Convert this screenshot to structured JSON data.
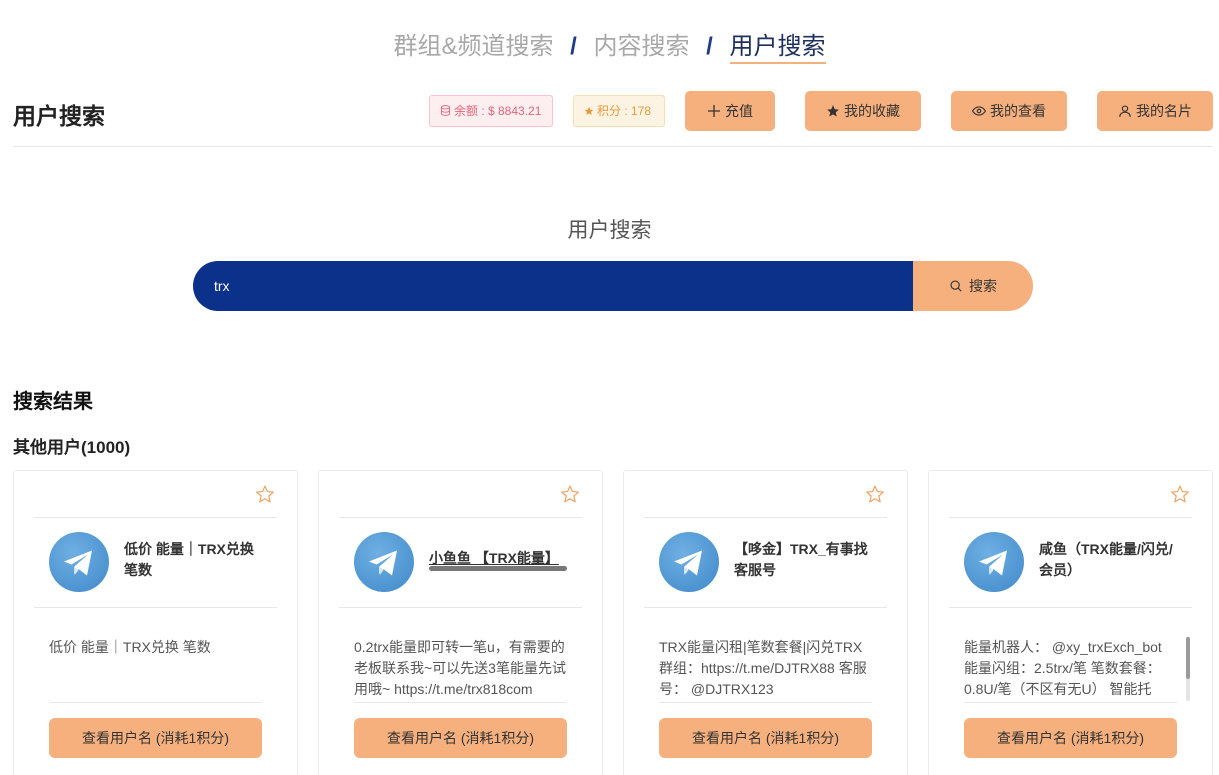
{
  "tabs": [
    {
      "label": "群组&频道搜索"
    },
    {
      "label": "内容搜索"
    },
    {
      "label": "用户搜索"
    }
  ],
  "tab_separator": "/",
  "header": {
    "title": "用户搜索",
    "balance": "余额 : $ 8843.21",
    "points": "积分 : 178",
    "recharge_label": "充值",
    "favorites_label": "我的收藏",
    "viewed_label": "我的查看",
    "card_label": "我的名片"
  },
  "search": {
    "title": "用户搜索",
    "value": "trx",
    "button_label": "搜索"
  },
  "results": {
    "title": "搜索结果",
    "others_title": "其他用户(1000)",
    "cards": [
      {
        "name": "低价 能量｜TRX兑换 笔数",
        "desc": "低价 能量｜TRX兑换 笔数",
        "button": "查看用户名 (消耗1积分)"
      },
      {
        "name": "小鱼鱼 【TRX能量】",
        "desc": "0.2trx能量即可转一笔u，有需要的老板联系我~可以先送3笔能量先试用哦~ https://t.me/trx818com",
        "button": "查看用户名 (消耗1积分)"
      },
      {
        "name": "【哆金】TRX_有事找客服号",
        "desc": "TRX能量闪租|笔数套餐|闪兑TRX 群组：https://t.me/DJTRX88 客服号： @DJTRX123",
        "button": "查看用户名 (消耗1积分)"
      },
      {
        "name": "咸鱼（TRX能量/闪兑/会员）",
        "desc": "能量机器人： @xy_trxExch_bot 能量闪组：2.5trx/笔 笔数套餐：0.8U/笔（不区有无U） 智能托",
        "button": "查看用户名 (消耗1积分)"
      }
    ]
  },
  "colors": {
    "accent": "#f6b07e",
    "search_bg": "#0b318a",
    "tab_active": "#1f2f5e",
    "balance_text": "#e2667a",
    "points_text": "#e89a3c"
  },
  "icons": {
    "balance": "database-icon",
    "points": "star-icon",
    "recharge": "plus-icon",
    "favorites": "star-filled-icon",
    "viewed": "eye-icon",
    "card": "user-icon",
    "search": "search-icon",
    "avatar": "telegram-icon",
    "favorite_toggle": "star-outline-icon"
  }
}
